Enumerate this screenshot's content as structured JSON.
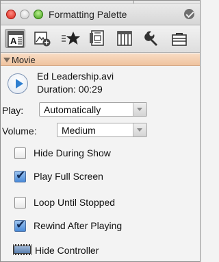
{
  "window": {
    "title": "Formatting Palette"
  },
  "toolbar": {
    "tools": [
      {
        "icon": "text-format-icon",
        "active": true
      },
      {
        "icon": "add-object-icon",
        "active": false
      },
      {
        "icon": "styles-star-icon",
        "active": false
      },
      {
        "icon": "document-icon",
        "active": false
      },
      {
        "icon": "columns-icon",
        "active": false
      },
      {
        "icon": "wrench-icon",
        "active": false
      },
      {
        "icon": "toolbox-icon",
        "active": false
      }
    ]
  },
  "section": {
    "label": "Movie"
  },
  "movie": {
    "file_name": "Ed Leadership.avi",
    "duration": "Duration: 00:29"
  },
  "play": {
    "label": "Play:",
    "value": "Automatically"
  },
  "volume": {
    "label": "Volume:",
    "value": "Medium"
  },
  "options": {
    "hide_during_show": {
      "label": "Hide During Show",
      "checked": false
    },
    "play_full_screen": {
      "label": "Play Full Screen",
      "checked": true
    },
    "loop_until_stopped": {
      "label": "Loop Until Stopped",
      "checked": false
    },
    "rewind_after_playing": {
      "label": "Rewind After Playing",
      "checked": true
    }
  },
  "hide_controller": {
    "label": "Hide Controller"
  },
  "colors": {
    "section_header": "#f5d2b4",
    "check_blue": "#4a8ad8",
    "close_red": "#d8261b",
    "zoom_green": "#3f9b17"
  }
}
